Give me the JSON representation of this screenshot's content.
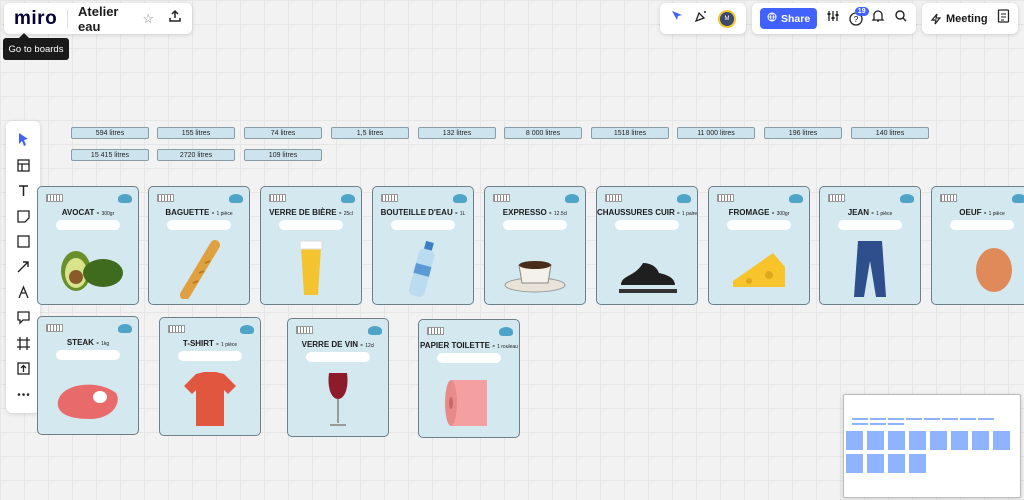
{
  "app": {
    "logo": "miro",
    "board_name": "Atelier eau",
    "tooltip": "Go to boards"
  },
  "header": {
    "share_label": "Share",
    "notification_count": "19",
    "avatar_initials": "M",
    "meeting_label": "Meeting"
  },
  "toolbar": {
    "tools": [
      "select-icon",
      "templates-icon",
      "text-icon",
      "sticky-note-icon",
      "shape-icon",
      "arrow-icon",
      "pen-icon",
      "comment-icon",
      "frame-icon",
      "upload-icon",
      "more-icon"
    ]
  },
  "answers": [
    "594 litres",
    "155 litres",
    "74 litres",
    "1,5 litres",
    "132 litres",
    "8 000 litres",
    "1518 litres",
    "11 000 litres",
    "196 litres",
    "140 litres",
    "15 415 litres",
    "2720 litres",
    "109 litres"
  ],
  "cards": [
    {
      "name": "AVOCAT",
      "qty": "300gr",
      "icon": "avocado-image"
    },
    {
      "name": "BAGUETTE",
      "qty": "1 pièce",
      "icon": "baguette-image"
    },
    {
      "name": "VERRE DE BIÈRE",
      "qty": "25cl",
      "icon": "beer-glass-image"
    },
    {
      "name": "BOUTEILLE D'EAU",
      "qty": "1L",
      "icon": "water-bottle-image"
    },
    {
      "name": "EXPRESSO",
      "qty": "12.5cl",
      "icon": "espresso-image"
    },
    {
      "name": "CHAUSSURES CUIR",
      "qty": "1 paire",
      "icon": "leather-shoes-image"
    },
    {
      "name": "FROMAGE",
      "qty": "300gr",
      "icon": "cheese-image"
    },
    {
      "name": "JEAN",
      "qty": "1 pièce",
      "icon": "jeans-image"
    },
    {
      "name": "OEUF",
      "qty": "1 pièce",
      "icon": "egg-image"
    },
    {
      "name": "STEAK",
      "qty": "1kg",
      "icon": "steak-image"
    },
    {
      "name": "T-SHIRT",
      "qty": "1 pièce",
      "icon": "tshirt-image"
    },
    {
      "name": "VERRE DE VIN",
      "qty": "12cl",
      "icon": "wine-glass-image"
    },
    {
      "name": "PAPIER TOILETTE",
      "qty": "1 rouleau",
      "icon": "toilet-paper-image"
    }
  ],
  "colors": {
    "accent": "#4262ff",
    "card_bg": "#d4e8f0",
    "chip_bg": "#cde4ee"
  }
}
